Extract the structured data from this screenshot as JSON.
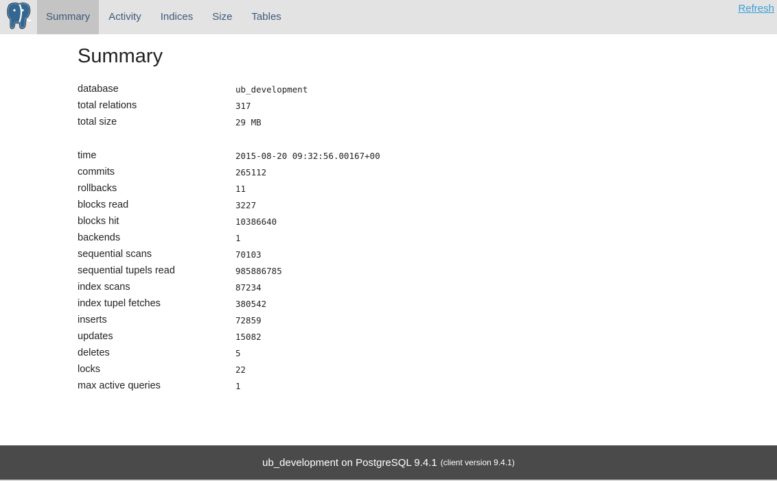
{
  "nav": {
    "tabs": [
      {
        "label": "Summary",
        "active": true
      },
      {
        "label": "Activity",
        "active": false
      },
      {
        "label": "Indices",
        "active": false
      },
      {
        "label": "Size",
        "active": false
      },
      {
        "label": "Tables",
        "active": false
      }
    ],
    "refresh_label": "Refresh",
    "logo_icon": "postgresql-elephant-icon"
  },
  "summary": {
    "title": "Summary",
    "group1": [
      {
        "label": "database",
        "value": "ub_development"
      },
      {
        "label": "total relations",
        "value": "317"
      },
      {
        "label": "total size",
        "value": "29 MB"
      }
    ],
    "group2": [
      {
        "label": "time",
        "value": "2015-08-20 09:32:56.00167+00"
      },
      {
        "label": "commits",
        "value": "265112"
      },
      {
        "label": "rollbacks",
        "value": "11"
      },
      {
        "label": "blocks read",
        "value": "3227"
      },
      {
        "label": "blocks hit",
        "value": "10386640"
      },
      {
        "label": "backends",
        "value": "1"
      },
      {
        "label": "sequential scans",
        "value": "70103"
      },
      {
        "label": "sequential tupels read",
        "value": "985886785"
      },
      {
        "label": "index scans",
        "value": "87234"
      },
      {
        "label": "index tupel fetches",
        "value": "380542"
      },
      {
        "label": "inserts",
        "value": "72859"
      },
      {
        "label": "updates",
        "value": "15082"
      },
      {
        "label": "deletes",
        "value": "5"
      },
      {
        "label": "locks",
        "value": "22"
      },
      {
        "label": "max active queries",
        "value": "1"
      }
    ]
  },
  "footer": {
    "main": "ub_development on PostgreSQL 9.4.1",
    "client": "(client version 9.4.1)"
  },
  "colors": {
    "nav_bg": "#e3e3e3",
    "tab_active_bg": "#c4c4c4",
    "tab_text": "#3d5a7a",
    "link": "#3aa0d8",
    "footer_bg": "#4a4a4a"
  }
}
